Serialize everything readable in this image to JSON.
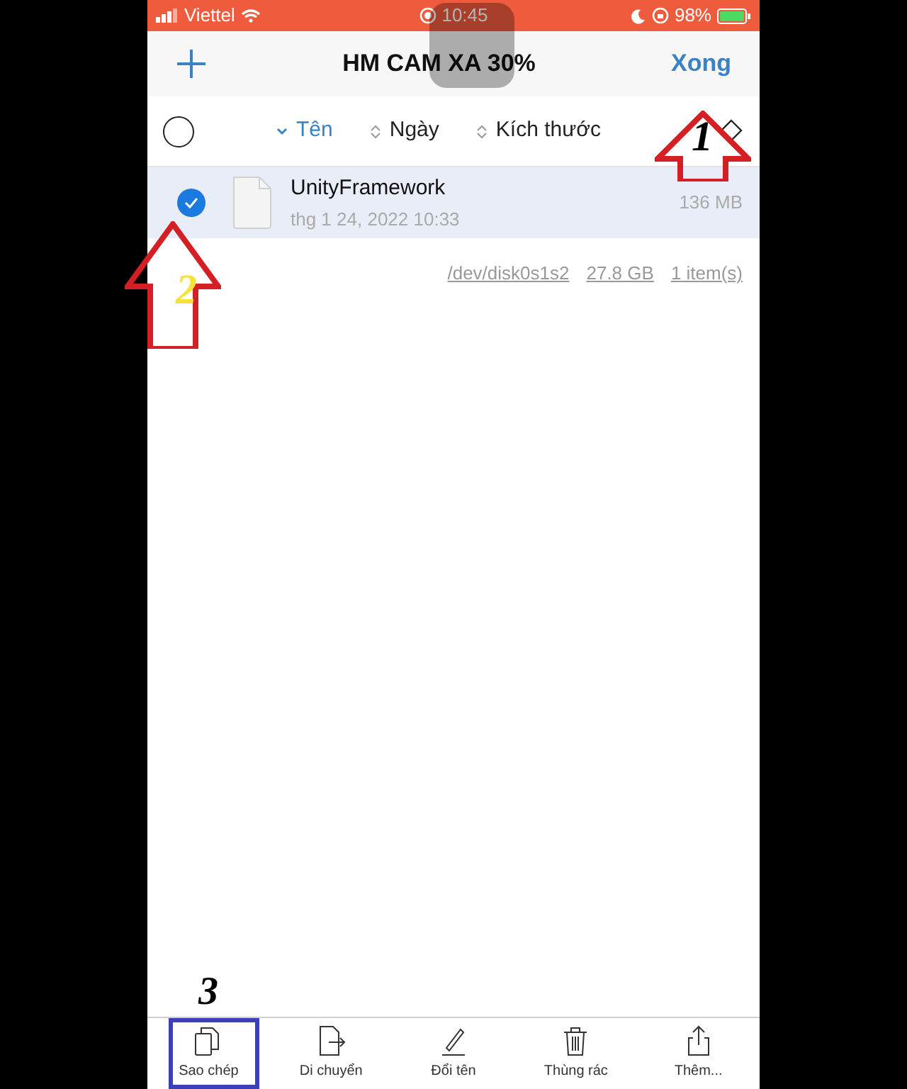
{
  "status_bar": {
    "carrier": "Viettel",
    "time": "10:45",
    "battery": "98%"
  },
  "nav_bar": {
    "title": "HM CAM XA 30%",
    "done_button": "Xong"
  },
  "sort_bar": {
    "select_all_checked": false,
    "columns": [
      {
        "label": "Tên",
        "selected": true
      },
      {
        "label": "Ngày",
        "selected": false
      },
      {
        "label": "Kích thước",
        "selected": false
      }
    ]
  },
  "files": [
    {
      "name": "UnityFramework",
      "date": "thg 1 24, 2022 10:33",
      "size": "136 MB",
      "checked": true
    }
  ],
  "footer": [
    "/dev/disk0s1s2",
    "27.8 GB",
    "1 item(s)"
  ],
  "toolbar": [
    {
      "kind": "copy",
      "label": "Sao chép"
    },
    {
      "kind": "move",
      "label": "Di chuyển"
    },
    {
      "kind": "rename",
      "label": "Đổi tên"
    },
    {
      "kind": "trash",
      "label": "Thùng rác"
    },
    {
      "kind": "share",
      "label": "Thêm..."
    }
  ],
  "annotations": [
    {
      "kind": "arrow",
      "label": "1"
    },
    {
      "kind": "arrow",
      "label": "2"
    },
    {
      "kind": "box",
      "label": "3"
    }
  ]
}
